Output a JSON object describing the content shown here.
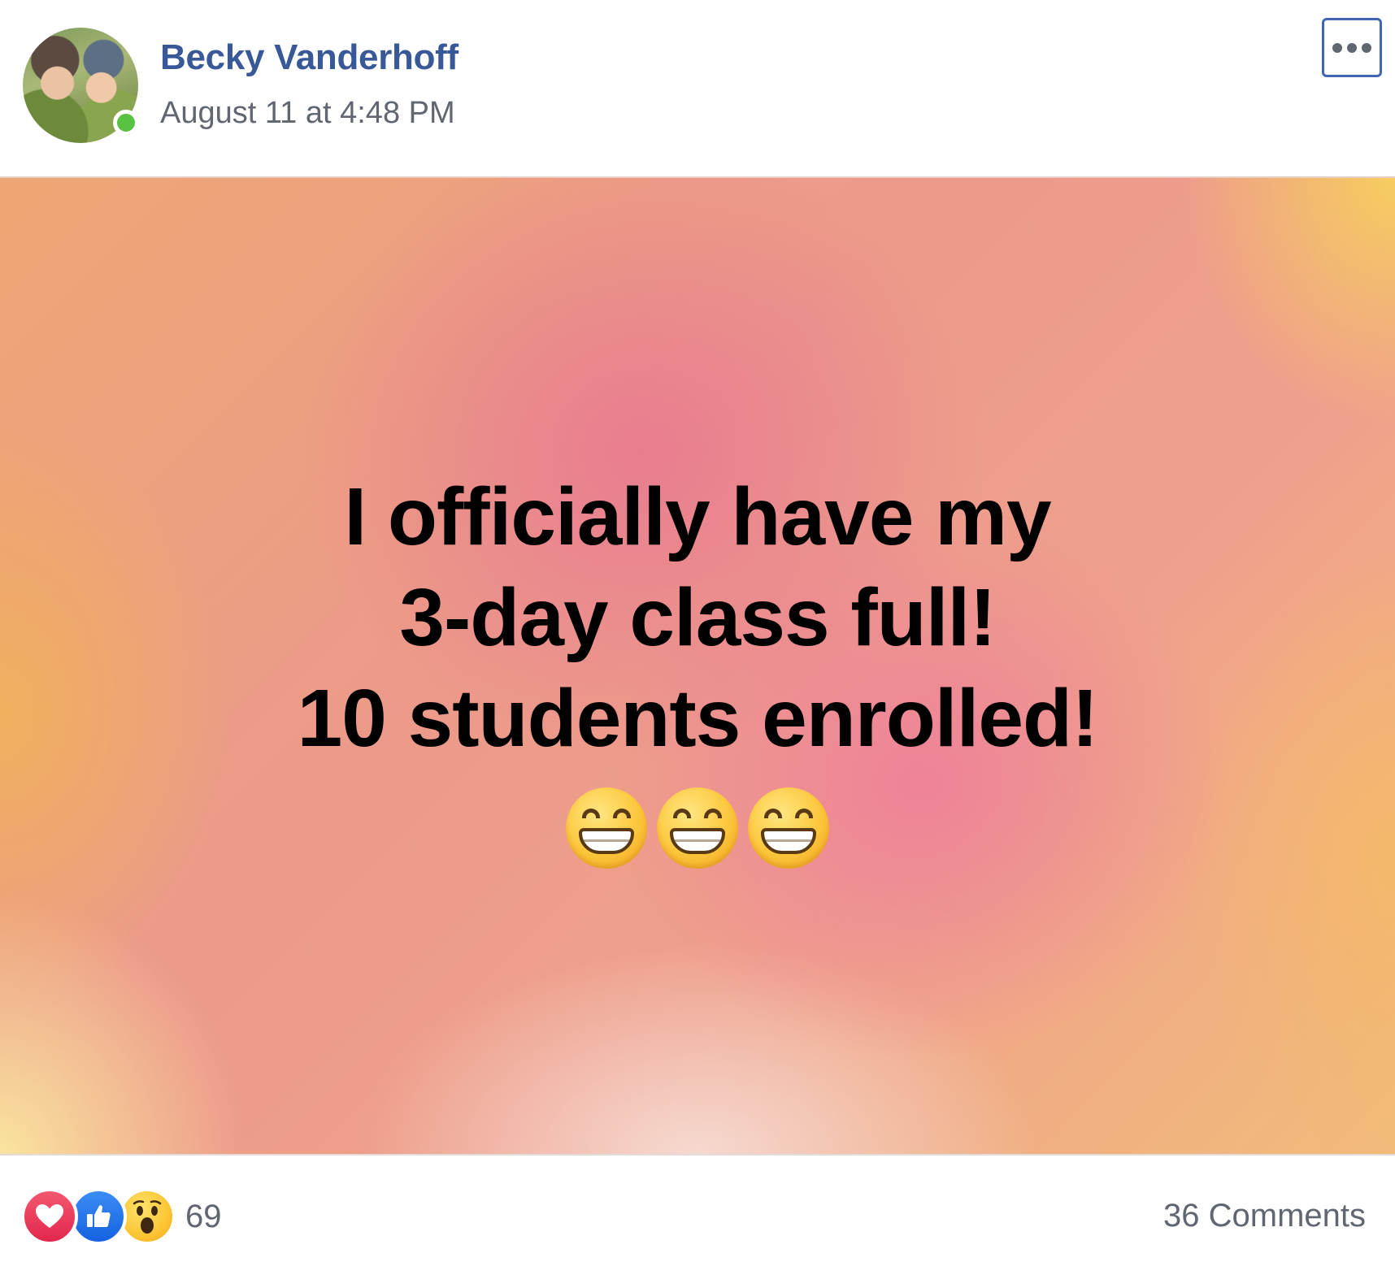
{
  "post": {
    "author_name": "Becky Vanderhoff",
    "timestamp": "August 11 at 4:48 PM",
    "online": true,
    "more_options_icon": "ellipsis-icon",
    "text_lines": [
      "I officially have my",
      "3-day class full!",
      "10 students enrolled!"
    ],
    "emojis": [
      "grinning-face-with-smiling-eyes",
      "grinning-face-with-smiling-eyes",
      "grinning-face-with-smiling-eyes"
    ]
  },
  "footer": {
    "reactions": [
      "love-reaction-icon",
      "like-reaction-icon",
      "wow-reaction-icon"
    ],
    "reaction_count": "69",
    "comments_label": "36 Comments"
  },
  "colors": {
    "author_blue": "#385898",
    "meta_gray": "#616770",
    "online_green": "#5ac242",
    "love_red": "#e2264d",
    "like_blue": "#1877f2"
  }
}
